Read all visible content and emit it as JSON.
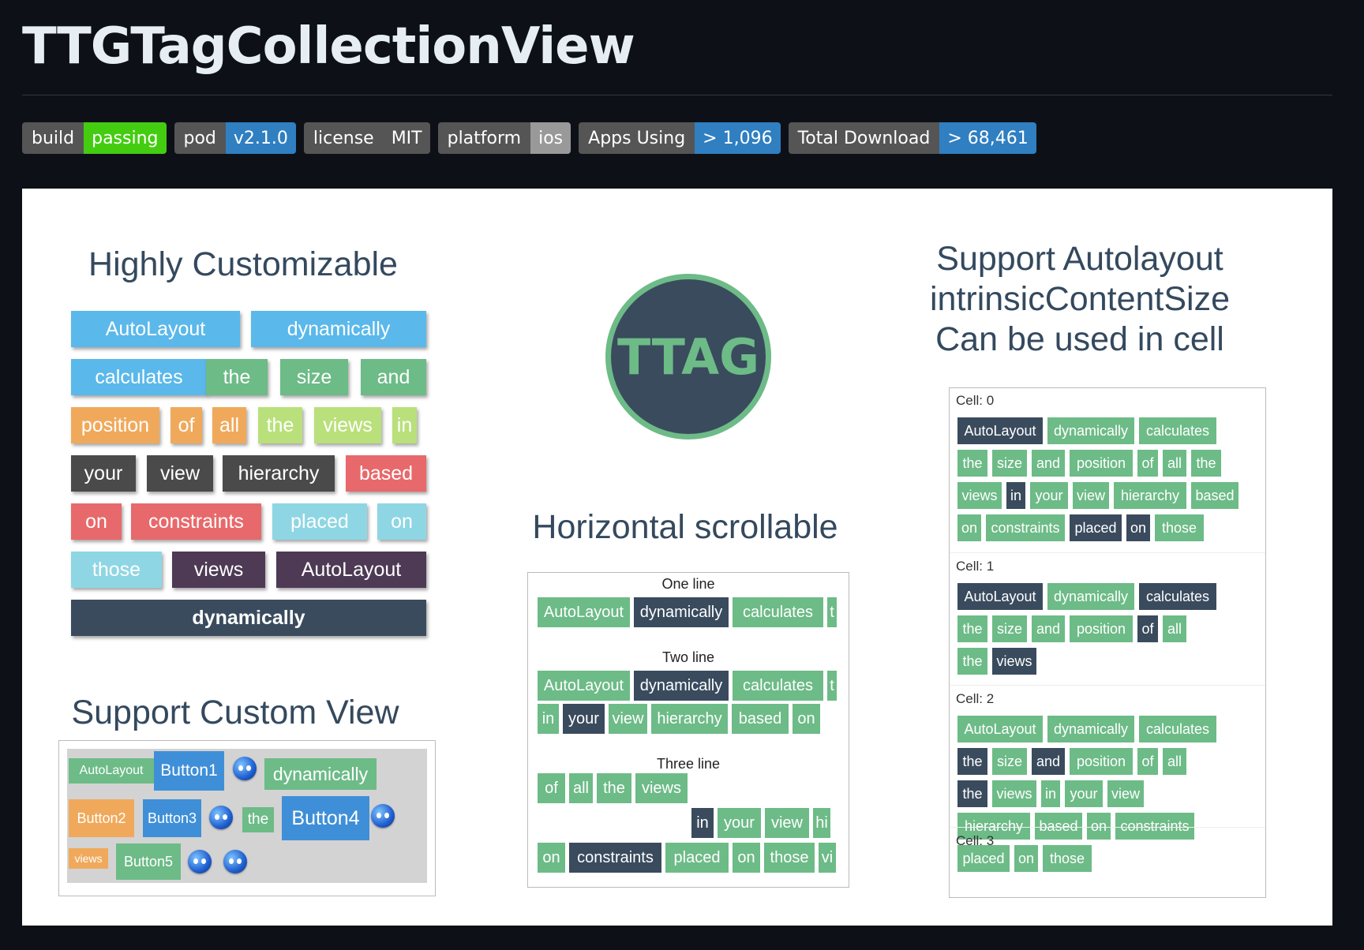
{
  "title": "TTGTagCollectionView",
  "badges": [
    {
      "left": "build",
      "right": "passing",
      "color": "#4c1"
    },
    {
      "left": "pod",
      "right": "v2.1.0",
      "color": "#2f7fc1"
    },
    {
      "left": "license",
      "right": "MIT",
      "color": "#555"
    },
    {
      "left": "platform",
      "right": "ios",
      "color": "#999"
    },
    {
      "left": "Apps Using",
      "right": "> 1,096",
      "color": "#2f7fc1"
    },
    {
      "left": "Total Download",
      "right": "> 68,461",
      "color": "#2f7fc1"
    }
  ],
  "customizable": {
    "title": "Highly Customizable",
    "tags": [
      "AutoLayout",
      "dynamically",
      "calculates",
      "the",
      "size",
      "and",
      "position",
      "of",
      "all",
      "the",
      "views",
      "in",
      "your",
      "view",
      "hierarchy",
      "based",
      "on",
      "constraints",
      "placed",
      "on",
      "those",
      "views",
      "AutoLayout",
      "dynamically"
    ]
  },
  "logo": {
    "text": "TTAG"
  },
  "custom_view": {
    "title": "Support Custom View",
    "items": [
      "AutoLayout",
      "Button1",
      "dynamically",
      "Button2",
      "Button3",
      "the",
      "Button4",
      "views",
      "Button5"
    ]
  },
  "horizontal": {
    "title": "Horizontal scrollable",
    "one_line": "One line",
    "two_line": "Two line",
    "three_line": "Three line",
    "row_a": [
      "AutoLayout",
      "dynamically",
      "calculates",
      "t"
    ],
    "row_b": [
      "in",
      "your",
      "view",
      "hierarchy",
      "based",
      "on"
    ],
    "row_c": [
      "AutoLayout",
      "dynamically",
      "calculates",
      "t"
    ],
    "row_d": [
      "of",
      "all",
      "the",
      "views",
      "in",
      "your",
      "view",
      "hi"
    ],
    "row_e": [
      "on",
      "constraints",
      "placed",
      "on",
      "those",
      "vi"
    ]
  },
  "autolayout": {
    "title_lines": [
      "Support Autolayout",
      "intrinsicContentSize",
      "Can be used in cell"
    ],
    "cells": [
      {
        "label": "Cell: 0",
        "rows": [
          [
            "AutoLayout",
            "dynamically",
            "calculates"
          ],
          [
            "the",
            "size",
            "and",
            "position",
            "of",
            "all",
            "the"
          ],
          [
            "views",
            "in",
            "your",
            "view",
            "hierarchy",
            "based"
          ],
          [
            "on",
            "constraints",
            "placed",
            "on",
            "those"
          ]
        ]
      },
      {
        "label": "Cell: 1",
        "rows": [
          [
            "AutoLayout",
            "dynamically",
            "calculates"
          ],
          [
            "the",
            "size",
            "and",
            "position",
            "of",
            "all"
          ],
          [
            "the",
            "views"
          ]
        ]
      },
      {
        "label": "Cell: 2",
        "rows": [
          [
            "AutoLayout",
            "dynamically",
            "calculates"
          ],
          [
            "the",
            "size",
            "and",
            "position",
            "of",
            "all"
          ],
          [
            "the",
            "views",
            "in",
            "your",
            "view"
          ],
          [
            "hierarchy",
            "based",
            "on",
            "constraints"
          ],
          [
            "placed",
            "on",
            "those"
          ]
        ]
      },
      {
        "label": "Cell: 3",
        "rows": []
      }
    ]
  },
  "colors": {
    "green": "#6dbb87",
    "dark": "#3a4b5e",
    "blue": "#5bb8ea",
    "orange": "#f0a95b",
    "lime": "#b9e07b",
    "gray": "#4a4a4a",
    "red": "#e8696b",
    "cyan": "#8fd6e4",
    "purple": "#4e3a55",
    "btnblue": "#3f8fd8"
  }
}
